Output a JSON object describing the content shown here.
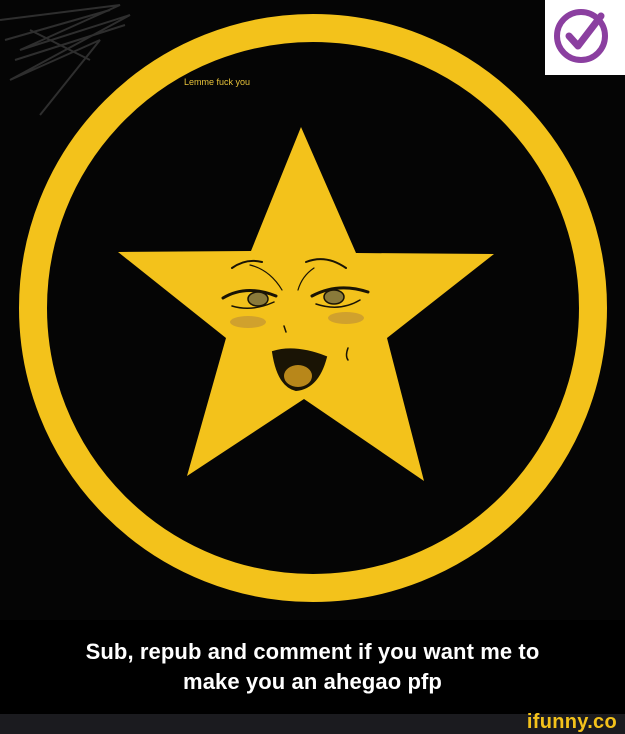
{
  "overlay_text": "Lemme fuck you",
  "caption": {
    "line1": "Sub, repub and comment if you want me to",
    "line2": "make you an ahegao pfp"
  },
  "watermark": "ifunny.co",
  "colors": {
    "background": "#050505",
    "ring": "#f3c21b",
    "star": "#f3c21b",
    "caption_bar": "#000000",
    "footer_bar": "#1b1b1f",
    "watermark": "#f3c21b",
    "check_badge": "#8b3fa0",
    "small_text": "#e8c33a"
  },
  "icons": {
    "badge": "purple-check-circle-icon",
    "scribble": "scribble-redaction-icon"
  }
}
